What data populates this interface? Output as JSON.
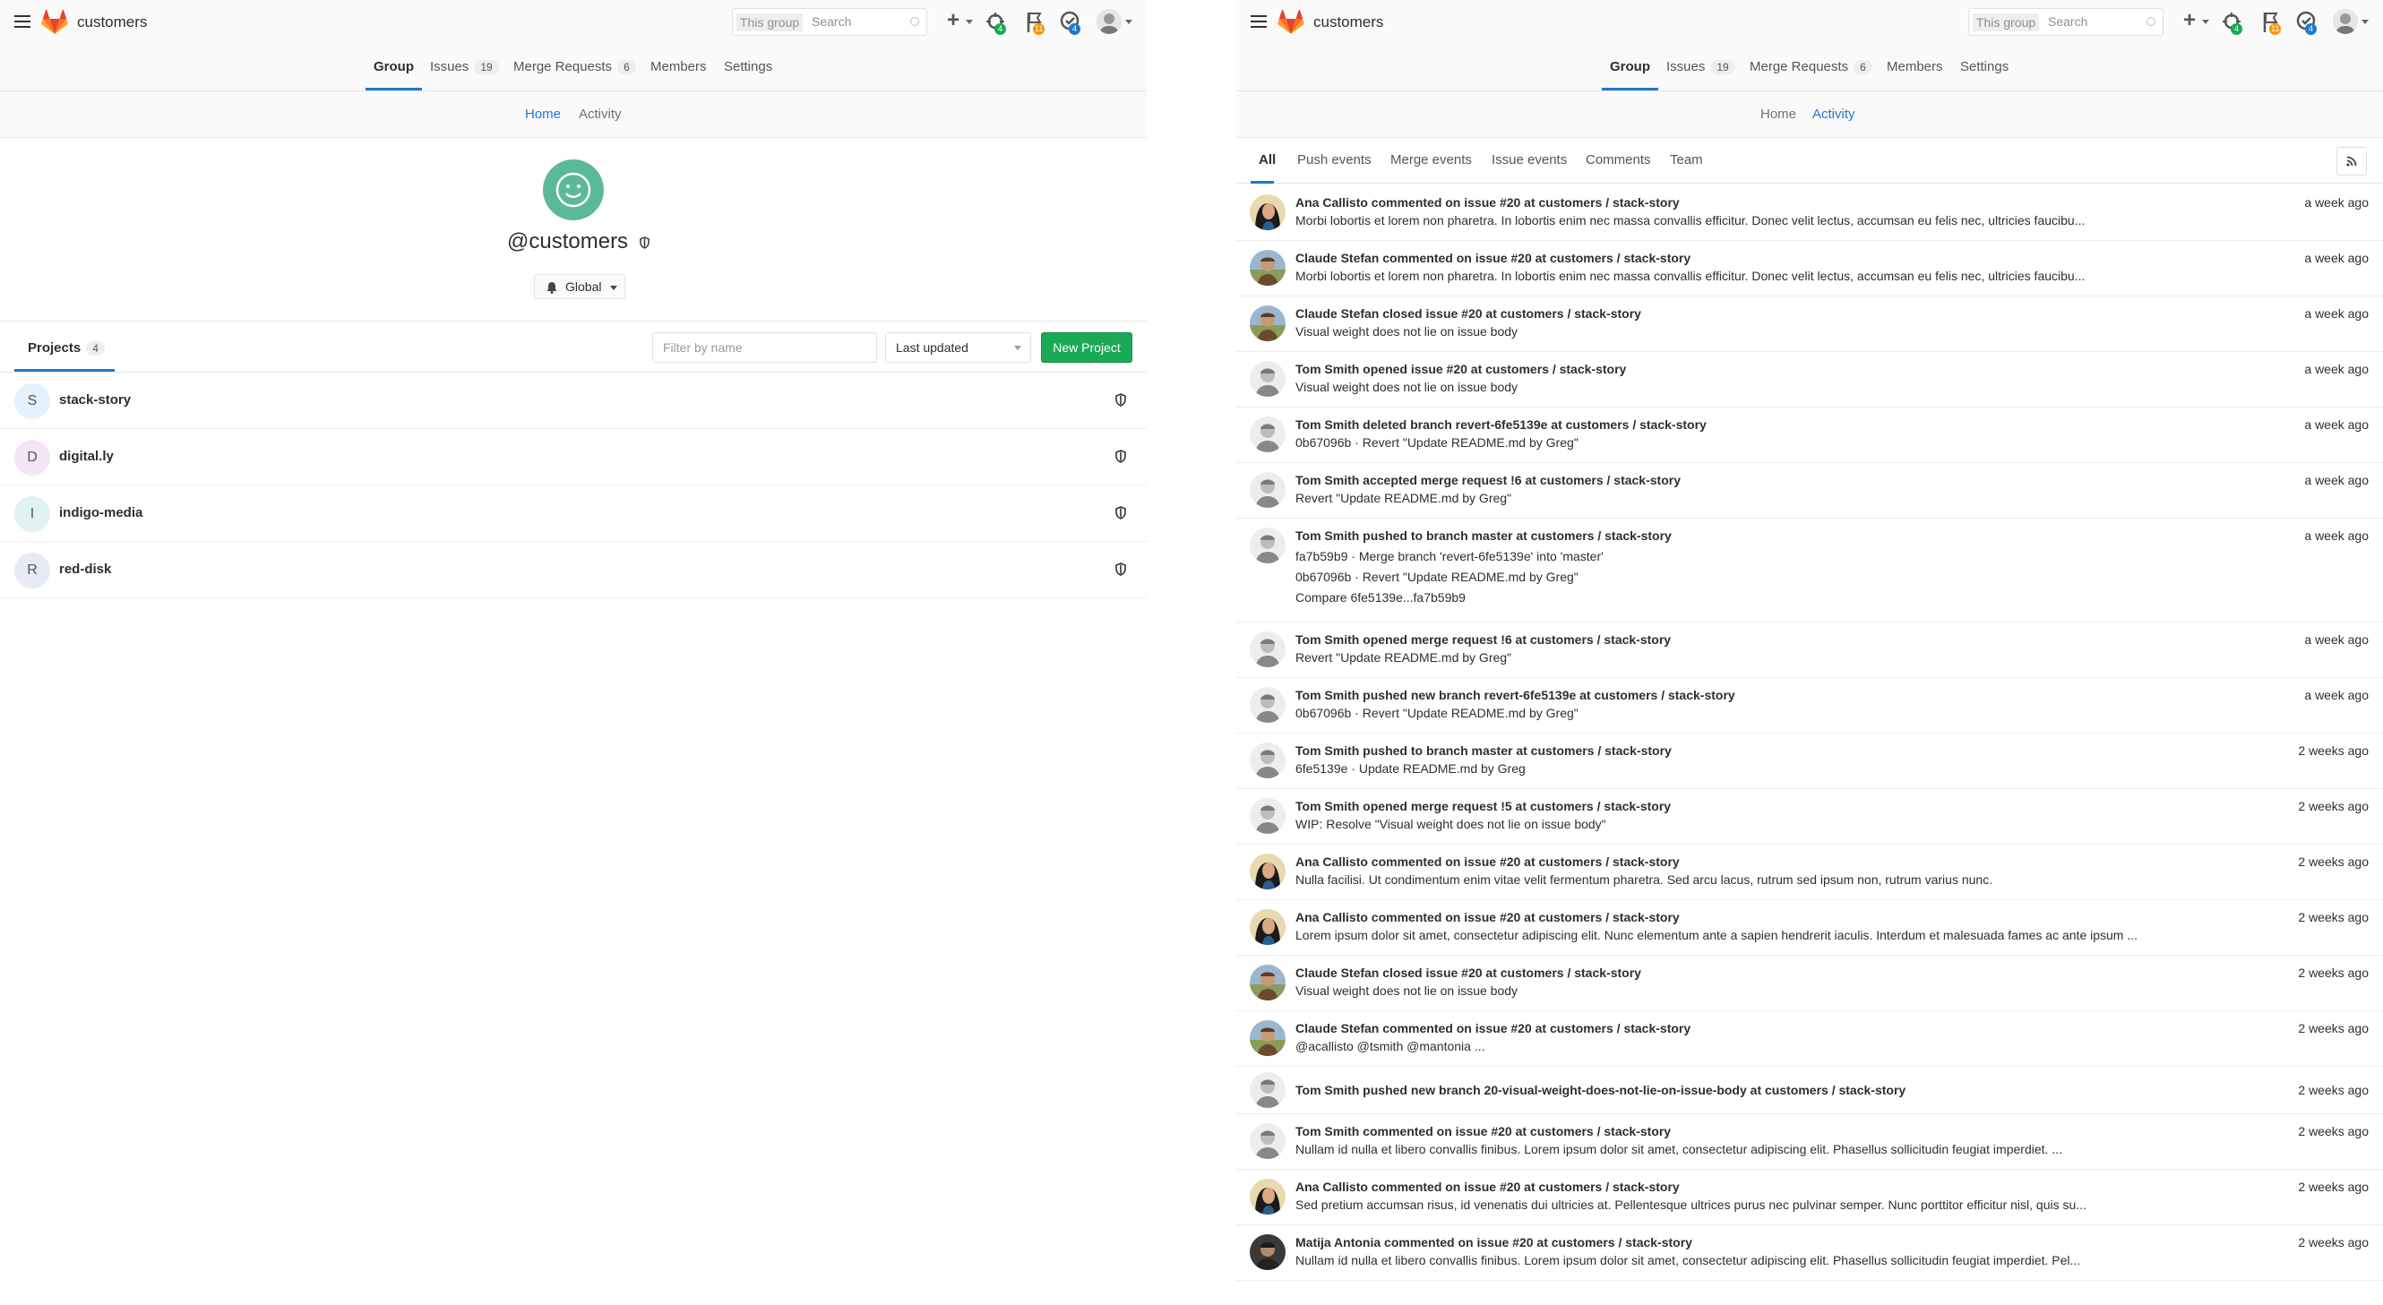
{
  "left": {
    "header": {
      "title": "customers",
      "search_scope": "This group",
      "search_placeholder": "Search",
      "todos_count": "4",
      "issues_count": "11",
      "mr_count": "4"
    },
    "nav_tabs": [
      {
        "label": "Group"
      },
      {
        "label": "Issues",
        "count": "19"
      },
      {
        "label": "Merge Requests",
        "count": "6"
      },
      {
        "label": "Members"
      },
      {
        "label": "Settings"
      }
    ],
    "sub_tabs": [
      {
        "label": "Home"
      },
      {
        "label": "Activity"
      }
    ],
    "group": {
      "name": "@customers",
      "notification": "Global"
    },
    "projects": {
      "tab_label": "Projects",
      "count": "4",
      "filter_placeholder": "Filter by name",
      "sort_label": "Last updated",
      "new_button": "New Project",
      "items": [
        {
          "initial": "S",
          "name": "stack-story",
          "color": "#e3f2fd"
        },
        {
          "initial": "D",
          "name": "digital.ly",
          "color": "#f3e5f5"
        },
        {
          "initial": "I",
          "name": "indigo-media",
          "color": "#e0f2f1"
        },
        {
          "initial": "R",
          "name": "red-disk",
          "color": "#e8eaf6"
        }
      ]
    }
  },
  "right": {
    "header": {
      "title": "customers",
      "search_scope": "This group",
      "search_placeholder": "Search",
      "todos_count": "4",
      "issues_count": "11",
      "mr_count": "4"
    },
    "nav_tabs": [
      {
        "label": "Group"
      },
      {
        "label": "Issues",
        "count": "19"
      },
      {
        "label": "Merge Requests",
        "count": "6"
      },
      {
        "label": "Members"
      },
      {
        "label": "Settings"
      }
    ],
    "sub_tabs": [
      {
        "label": "Home"
      },
      {
        "label": "Activity"
      }
    ],
    "event_tabs": [
      "All",
      "Push events",
      "Merge events",
      "Issue events",
      "Comments",
      "Team"
    ],
    "events": [
      {
        "avatar": "ana",
        "header": "Ana Callisto commented on issue #20 at customers / stack-story",
        "lines": [
          "Morbi lobortis et lorem non pharetra. In lobortis enim nec massa convallis efficitur. Donec velit lectus, accumsan eu felis nec, ultricies faucibu..."
        ],
        "time": "a week ago"
      },
      {
        "avatar": "claude",
        "header": "Claude Stefan commented on issue #20 at customers / stack-story",
        "lines": [
          "Morbi lobortis et lorem non pharetra. In lobortis enim nec massa convallis efficitur. Donec velit lectus, accumsan eu felis nec, ultricies faucibu..."
        ],
        "time": "a week ago"
      },
      {
        "avatar": "claude",
        "header": "Claude Stefan closed issue #20 at customers / stack-story",
        "lines": [
          "Visual weight does not lie on issue body"
        ],
        "time": "a week ago"
      },
      {
        "avatar": "tom",
        "header": "Tom Smith opened issue #20 at customers / stack-story",
        "lines": [
          "Visual weight does not lie on issue body"
        ],
        "time": "a week ago"
      },
      {
        "avatar": "tom",
        "header": "Tom Smith deleted branch revert-6fe5139e at customers / stack-story",
        "lines": [
          "0b67096b · Revert \"Update README.md by Greg\""
        ],
        "time": "a week ago"
      },
      {
        "avatar": "tom",
        "header": "Tom Smith accepted merge request !6 at customers / stack-story",
        "lines": [
          "Revert \"Update README.md by Greg\""
        ],
        "time": "a week ago"
      },
      {
        "avatar": "tom",
        "header": "Tom Smith pushed to branch master at customers / stack-story",
        "lines": [
          "fa7b59b9 · Merge branch 'revert-6fe5139e' into 'master'",
          "0b67096b · Revert \"Update README.md by Greg\"",
          "Compare 6fe5139e...fa7b59b9"
        ],
        "time": "a week ago"
      },
      {
        "avatar": "tom",
        "header": "Tom Smith opened merge request !6 at customers / stack-story",
        "lines": [
          "Revert \"Update README.md by Greg\""
        ],
        "time": "a week ago"
      },
      {
        "avatar": "tom",
        "header": "Tom Smith pushed new branch revert-6fe5139e at customers / stack-story",
        "lines": [
          "0b67096b · Revert \"Update README.md by Greg\""
        ],
        "time": "a week ago"
      },
      {
        "avatar": "tom",
        "header": "Tom Smith pushed to branch master at customers / stack-story",
        "lines": [
          "6fe5139e · Update README.md by Greg"
        ],
        "time": "2 weeks ago"
      },
      {
        "avatar": "tom",
        "header": "Tom Smith opened merge request !5 at customers / stack-story",
        "lines": [
          "WIP: Resolve \"Visual weight does not lie on issue body\""
        ],
        "time": "2 weeks ago"
      },
      {
        "avatar": "ana",
        "header": "Ana Callisto commented on issue #20 at customers / stack-story",
        "lines": [
          "Nulla facilisi. Ut condimentum enim vitae velit fermentum pharetra. Sed arcu lacus, rutrum sed ipsum non, rutrum varius nunc."
        ],
        "time": "2 weeks ago"
      },
      {
        "avatar": "ana",
        "header": "Ana Callisto commented on issue #20 at customers / stack-story",
        "lines": [
          "Lorem ipsum dolor sit amet, consectetur adipiscing elit. Nunc elementum ante a sapien hendrerit iaculis. Interdum et malesuada fames ac ante ipsum ..."
        ],
        "time": "2 weeks ago"
      },
      {
        "avatar": "claude",
        "header": "Claude Stefan closed issue #20 at customers / stack-story",
        "lines": [
          "Visual weight does not lie on issue body"
        ],
        "time": "2 weeks ago"
      },
      {
        "avatar": "claude",
        "header": "Claude Stefan commented on issue #20 at customers / stack-story",
        "lines": [
          "@acallisto @tsmith @mantonia ..."
        ],
        "time": "2 weeks ago"
      },
      {
        "avatar": "tom",
        "header": "Tom Smith pushed new branch 20-visual-weight-does-not-lie-on-issue-body at customers / stack-story",
        "lines": [],
        "time": "2 weeks ago"
      },
      {
        "avatar": "tom",
        "header": "Tom Smith commented on issue #20 at customers / stack-story",
        "lines": [
          "Nullam id nulla et libero convallis finibus. Lorem ipsum dolor sit amet, consectetur adipiscing elit. Phasellus sollicitudin feugiat imperdiet. ..."
        ],
        "time": "2 weeks ago"
      },
      {
        "avatar": "ana",
        "header": "Ana Callisto commented on issue #20 at customers / stack-story",
        "lines": [
          "Sed pretium accumsan risus, id venenatis dui ultricies at. Pellentesque ultrices purus nec pulvinar semper. Nunc porttitor efficitur nisl, quis su..."
        ],
        "time": "2 weeks ago"
      },
      {
        "avatar": "matija",
        "header": "Matija Antonia commented on issue #20 at customers / stack-story",
        "lines": [
          "Nullam id nulla et libero convallis finibus. Lorem ipsum dolor sit amet, consectetur adipiscing elit. Phasellus sollicitudin feugiat imperdiet. Pel..."
        ],
        "time": "2 weeks ago"
      }
    ]
  },
  "colors": {
    "accent": "#1f78d1",
    "success": "#1aaa55",
    "todo_badge": "#1aaa55",
    "issues_badge": "#fc9403",
    "mr_badge": "#1f78d1"
  }
}
